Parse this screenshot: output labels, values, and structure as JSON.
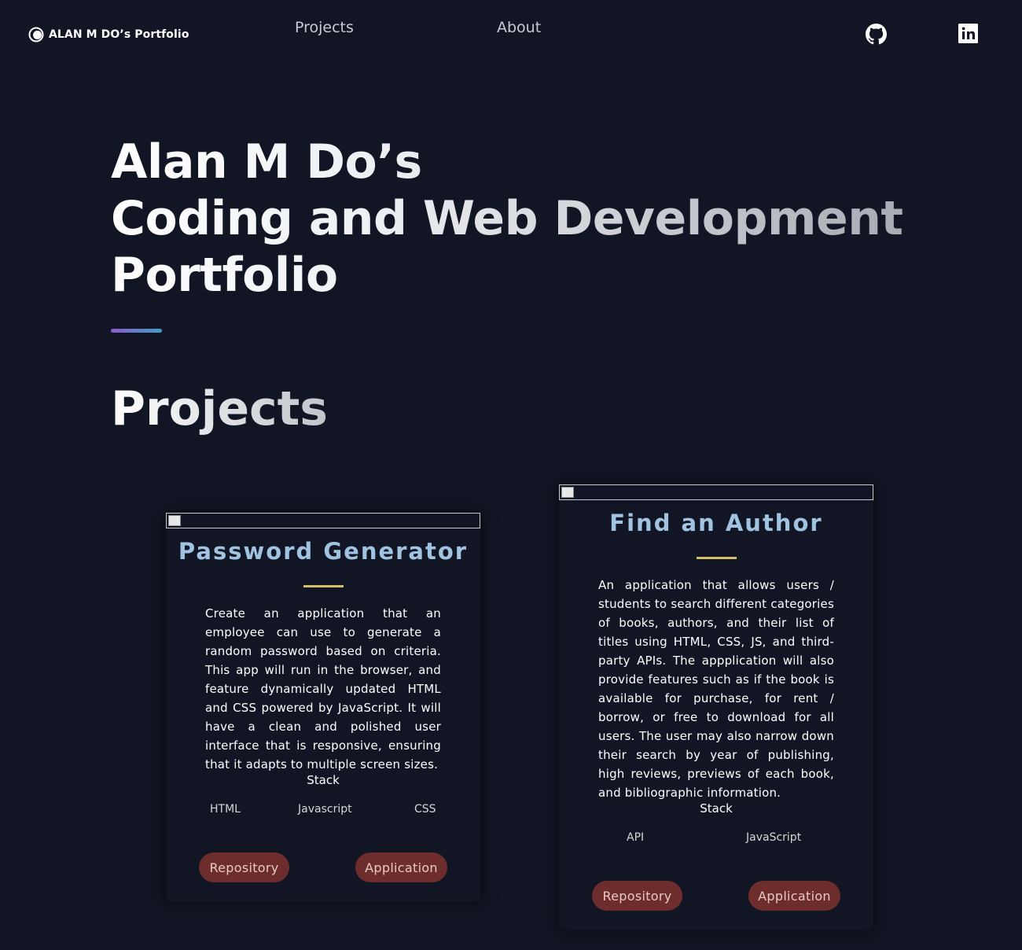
{
  "nav": {
    "brand": "ALAN M DO’s Portfolio",
    "links": [
      "Projects",
      "About"
    ],
    "social": [
      "github-icon",
      "linkedin-icon"
    ]
  },
  "hero": {
    "title_line1": "Alan M Do’s",
    "title_line2": "Coding and Web Development",
    "title_line3": "Portfolio"
  },
  "projects_heading": "Projects",
  "projects": [
    {
      "title": "Password Generator",
      "description": "Create an application that an employee can use to generate a random password based on criteria. This app will run in the browser, and feature dynamically updated HTML and CSS powered by JavaScript. It will have a clean and polished user interface that is responsive, ensuring that it adapts to multiple screen sizes.",
      "stack_label": "Stack",
      "stack": [
        "HTML",
        "Javascript",
        "CSS"
      ],
      "buttons": [
        "Repository",
        "Application"
      ]
    },
    {
      "title": "Find an Author",
      "description": "An application that allows users / students to search different categories of books, authors, and their list of titles using HTML, CSS, JS, and third-party APIs. The appplication will also provide features such as if the book is available for purchase, for rent / borrow, or free to download for all users. The user may also narrow down their search by year of publishing, high reviews, previews of each book, and bibliographic information.",
      "stack_label": "Stack",
      "stack": [
        "API",
        "JavaScript"
      ],
      "buttons": [
        "Repository",
        "Application"
      ]
    }
  ],
  "colors": {
    "background": "#121624",
    "card_title": "#9fc3e0",
    "card_divider": "#d4bf6a",
    "button_bg": "#6e2d2d",
    "button_text": "#e6c9c3"
  }
}
